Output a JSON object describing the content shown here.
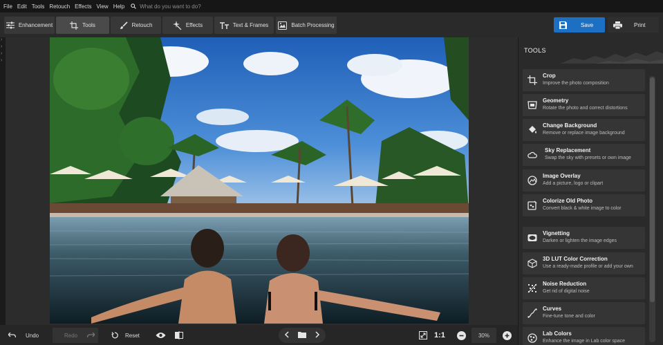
{
  "menu": {
    "items": [
      "File",
      "Edit",
      "Tools",
      "Retouch",
      "Effects",
      "View",
      "Help"
    ],
    "search_placeholder": "What do you want to do?"
  },
  "toolbar": {
    "tabs": [
      {
        "label": "Enhancement",
        "icon": "sliders-icon",
        "active": false
      },
      {
        "label": "Tools",
        "icon": "crop-icon",
        "active": true
      },
      {
        "label": "Retouch",
        "icon": "brush-icon",
        "active": false
      },
      {
        "label": "Effects",
        "icon": "sparkle-icon",
        "active": false
      },
      {
        "label": "Text & Frames",
        "icon": "text-icon",
        "active": false
      },
      {
        "label": "Batch Processing",
        "icon": "images-icon",
        "active": false
      }
    ],
    "save_label": "Save",
    "print_label": "Print",
    "accent_color": "#1c6fc2"
  },
  "bottom": {
    "undo_label": "Undo",
    "redo_label": "Redo",
    "reset_label": "Reset",
    "ratio_label": "1:1",
    "zoom_value": "30%"
  },
  "panel": {
    "title": "TOOLS",
    "tools": [
      {
        "name": "Crop",
        "desc": "Improve the photo composition",
        "icon": "crop-icon"
      },
      {
        "name": "Geometry",
        "desc": "Rotate the photo and correct distortions",
        "icon": "geometry-icon"
      },
      {
        "name": "Change Background",
        "desc": "Remove or replace image background",
        "icon": "paint-bucket-icon"
      },
      {
        "name": "Sky Replacement",
        "desc": "Swap the sky with presets or own image",
        "icon": "cloud-icon"
      },
      {
        "name": "Image Overlay",
        "desc": "Add a picture, logo or clipart",
        "icon": "overlay-icon"
      },
      {
        "name": "Colorize Old Photo",
        "desc": "Convert black & white image to color",
        "icon": "colorize-icon"
      },
      {
        "name": "Vignetting",
        "desc": "Darken or lighten the image edges",
        "icon": "vignette-icon"
      },
      {
        "name": "3D LUT Color Correction",
        "desc": "Use a ready-made profile or add your own",
        "icon": "cube-icon"
      },
      {
        "name": "Noise Reduction",
        "desc": "Get rid of digital noise",
        "icon": "noise-icon"
      },
      {
        "name": "Curves",
        "desc": "Fine-tune tone and color",
        "icon": "curves-icon"
      },
      {
        "name": "Lab Colors",
        "desc": "Enhance the image in Lab color space",
        "icon": "lab-icon"
      }
    ]
  }
}
